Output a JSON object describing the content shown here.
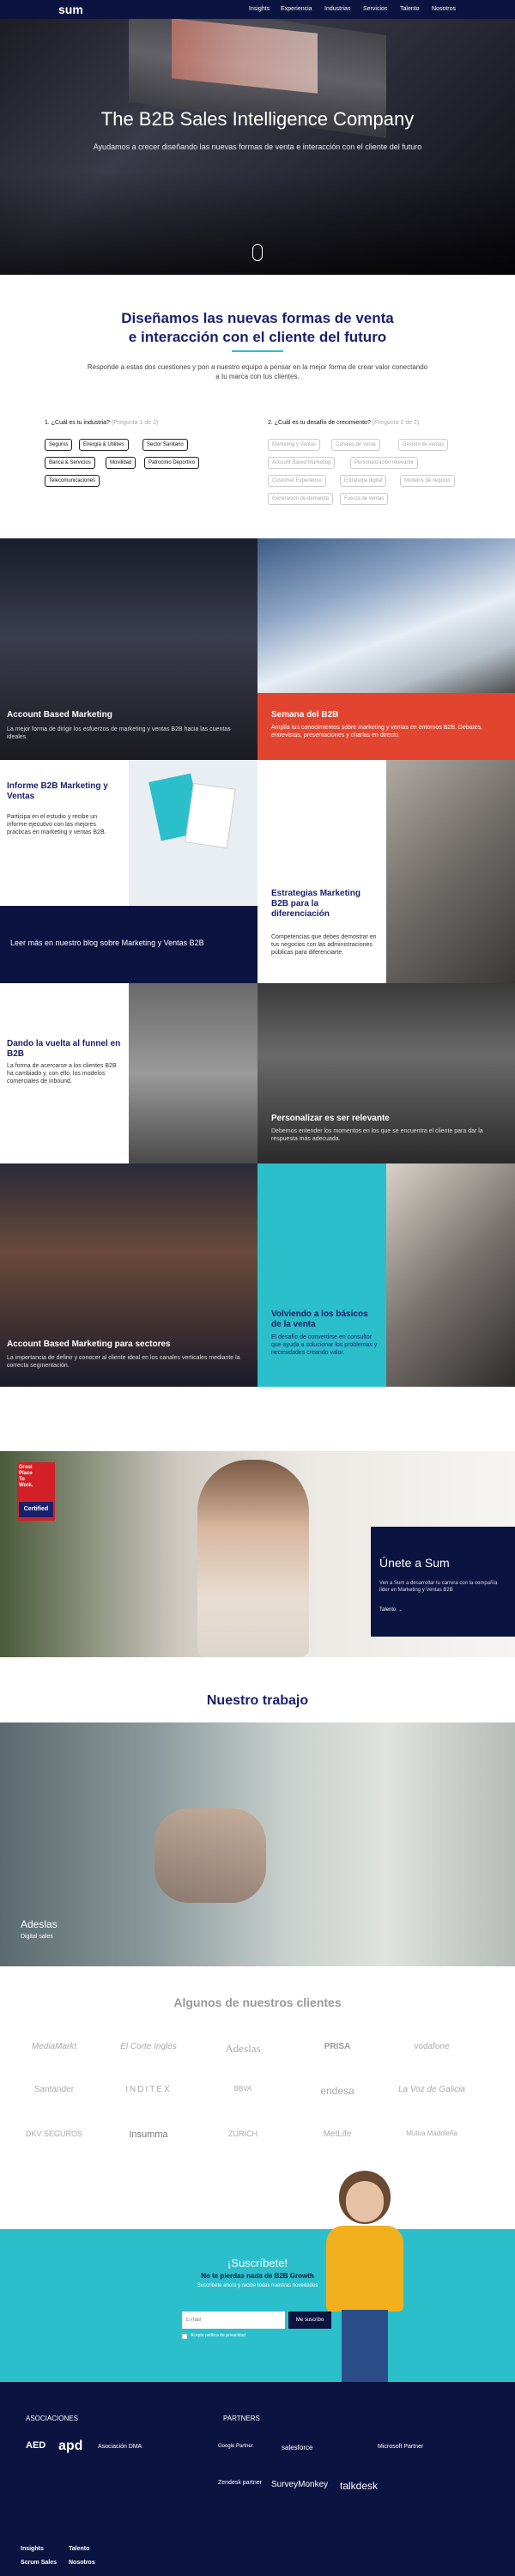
{
  "nav": {
    "logo": "sum",
    "links": [
      "Insights",
      "Experiencia",
      "Industrias",
      "Servicios",
      "Talento",
      "Nosotros"
    ]
  },
  "hero": {
    "title": "The B2B Sales Intelligence Company",
    "subtitle": "Ayudamos a crecer diseñando las nuevas formas de venta e interacción con el cliente del futuro"
  },
  "design": {
    "title_line1": "Diseñamos las nuevas formas de venta",
    "title_line2": "e interacción con el cliente del futuro",
    "description": "Responde a estas dos cuestiones y pon a nuestro equipo a pensar en la mejor forma de crear valor conectando a tu marca con tus clientes.",
    "q1_label": "1. ¿Cuál es tu industria?",
    "q1_hint": "(Pregunta 1 de 2)",
    "q1_options": [
      "Seguros",
      "Energía & Utilities",
      "Sector Sanitario",
      "Banca & Servicios",
      "Movilidad",
      "Patrocinio Deportivo",
      "Telecomunicaciones"
    ],
    "q2_label": "2. ¿Cuál es tu desafío de crecimiento?",
    "q2_hint": "(Pregunta 2 de 2)",
    "q2_options": [
      "Marketing y Ventas",
      "Canales de venta",
      "Gestión de ventas",
      "Account Based Marketing",
      "Personalización relevante",
      "Customer Experience",
      "Estrategia digital",
      "Modelos de negocio",
      "Generación de demanda",
      "Fuerza de ventas"
    ]
  },
  "tiles": {
    "abm": {
      "title": "Account Based Marketing",
      "desc": "La mejor forma de dirigir los esfuerzos de marketing y ventas B2B hacia las cuentas ideales."
    },
    "semana": {
      "title": "Semana del B2B",
      "desc": "Amplía tus conocimientos sobre marketing y ventas en entornos B2B. Debates, entrevistas, presentaciones y charlas en directo."
    },
    "informe": {
      "title": "Informe B2B Marketing y Ventas",
      "desc": "Participa en el estudio y recibe un informe ejecutivo con las mejores prácticas en marketing y ventas B2B."
    },
    "estrategias": {
      "title": "Estrategias Marketing B2B para la diferenciación",
      "desc": "Competencias que debes demostrar en tus negocios con las administraciones públicas para diferenciarte."
    },
    "blog": "Leer más en nuestro blog sobre Marketing y Ventas B2B",
    "funnel": {
      "title": "Dando la vuelta al funnel en B2B",
      "desc": "La forma de acercarse a los clientes B2B ha cambiado y, con ello, los modelos comerciales de inbound."
    },
    "personalizar": {
      "title": "Personalizar es ser relevante",
      "desc": "Debemos entender los momentos en los que se encuentra el cliente para dar la respuesta más adecuada."
    },
    "abm_sectores": {
      "title": "Account Based Marketing para sectores",
      "desc": "La importancia de definir y conocer al cliente ideal en los canales verticales mediante la correcta segmentación."
    },
    "volviendo": {
      "title": "Volviendo a los básicos de la venta",
      "desc": "El desafío de convertirse en consultor que ayuda a solucionar los problemas y necesidades creando valor."
    }
  },
  "join": {
    "gptw_line1": "Great",
    "gptw_line2": "Place",
    "gptw_line3": "To",
    "gptw_line4": "Work.",
    "gptw_badge": "Certified",
    "title": "Únete a Sum",
    "desc": "Ven a Sum a desarrollar tu carrera con la compañía líder en Marketing y Ventas B2B",
    "link": "Talento →"
  },
  "work": {
    "title": "Nuestro trabajo",
    "project": "Adeslas",
    "tag": "Digital sales"
  },
  "clients": {
    "title": "Algunos de nuestros clientes",
    "logos": [
      "MediaMarkt",
      "El Corte Inglés",
      "Adeslas",
      "PRISA",
      "vodafone",
      "Santander",
      "INDITEX",
      "BBVA",
      "endesa",
      "La Voz de Galicia",
      "DKV SEGUROS",
      "Insumma",
      "ZURICH",
      "MetLife",
      "Mutua Madrileña"
    ]
  },
  "subscribe": {
    "title": "¡Suscríbete!",
    "sub": "No te pierdas nada de B2B Growth",
    "sub2": "Suscríbete ahora y recibe todas nuestras novedades",
    "email_placeholder": "E-mail",
    "button": "Me suscribo",
    "checkbox": "Acepto política de privacidad"
  },
  "footer": {
    "assoc_title": "ASOCIACIONES",
    "assoc_logos": [
      "AED",
      "apd",
      "Asociación DMA"
    ],
    "partners_title": "PARTNERS",
    "partners_logos": [
      "Google Partner",
      "salesforce",
      "Microsoft Partner",
      "Zendesk partner",
      "SurveyMonkey",
      "talkdesk"
    ],
    "links": [
      "Insights",
      "Talento",
      "Scrum Sales",
      "Nosotros"
    ]
  },
  "colors": {
    "navy": "#0b1340",
    "teal": "#2bbfcc",
    "red": "#e2452f"
  }
}
